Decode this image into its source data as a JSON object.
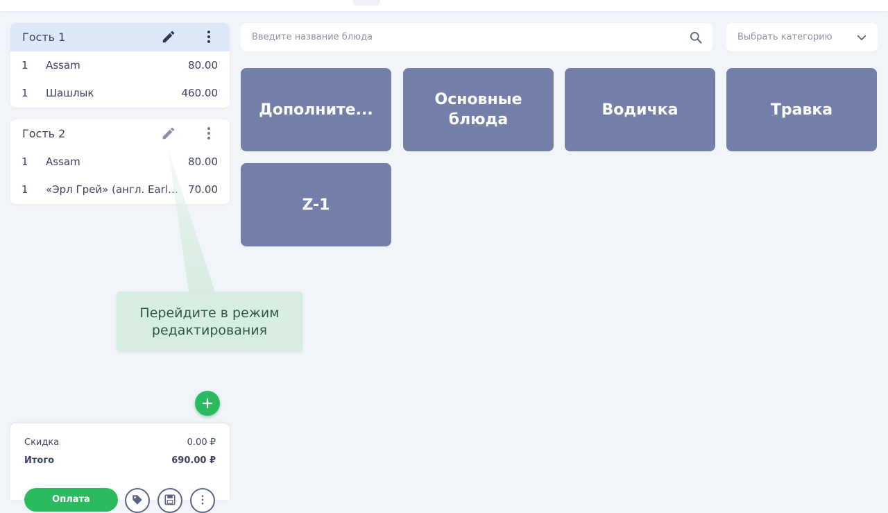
{
  "guests": [
    {
      "name": "Гость 1",
      "items": [
        {
          "qty": "1",
          "name": "Assam",
          "price": "80.00"
        },
        {
          "qty": "1",
          "name": "Шашлык",
          "price": "460.00"
        }
      ]
    },
    {
      "name": "Гость 2",
      "items": [
        {
          "qty": "1",
          "name": "Assam",
          "price": "80.00"
        },
        {
          "qty": "1",
          "name": "«Эрл Грей» (англ. Earl ...",
          "price": "70.00"
        }
      ]
    }
  ],
  "search": {
    "placeholder": "Введите название блюда"
  },
  "category_select": {
    "label": "Выбрать категорию"
  },
  "categories": [
    {
      "label": "Дополните..."
    },
    {
      "label": "Основные\nблюда"
    },
    {
      "label": "Водичка"
    },
    {
      "label": "Травка"
    },
    {
      "label": "Z-1"
    }
  ],
  "tooltip": {
    "text": "Перейдите в режим редактирования"
  },
  "totals": {
    "discount_label": "Скидка",
    "discount_value": "0.00 ₽",
    "total_label": "Итого",
    "total_value": "690.00 ₽"
  },
  "actions": {
    "pay_label": "Оплата"
  },
  "colors": {
    "tile": "#7580aa",
    "accent_green": "#2bba5e",
    "selected_header": "#dfe8f8",
    "tooltip_bg": "#d8ede1"
  }
}
